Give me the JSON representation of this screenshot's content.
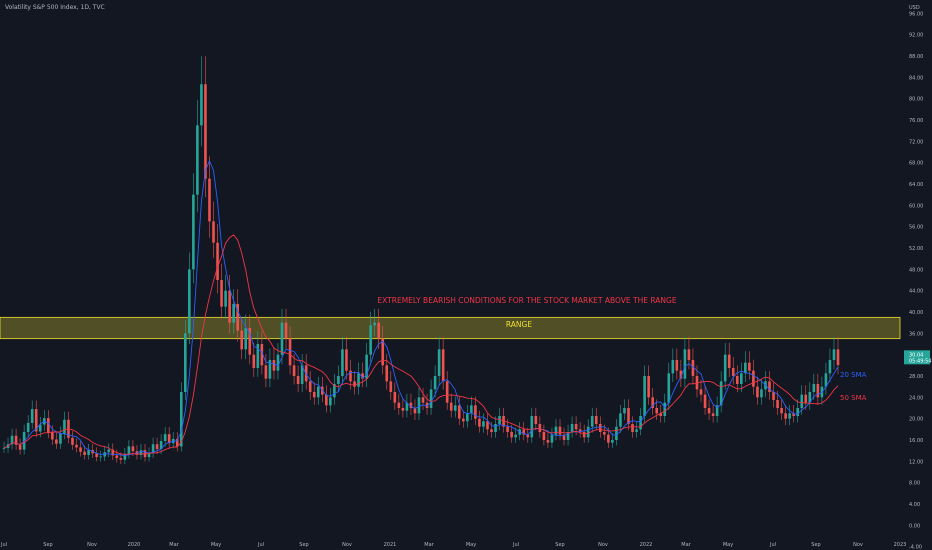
{
  "chart_data": {
    "type": "candlestick",
    "title": "Volatility S&P 500 Index, 1D, TVC",
    "currency": "USD",
    "ylim": [
      -2,
      97
    ],
    "yticks": [
      "96.00",
      "92.00",
      "88.00",
      "84.00",
      "80.00",
      "76.00",
      "72.00",
      "68.00",
      "64.00",
      "60.00",
      "56.00",
      "52.00",
      "48.00",
      "44.00",
      "40.00",
      "36.00",
      "32.00",
      "28.00",
      "24.00",
      "20.00",
      "16.00",
      "12.00",
      "8.00",
      "4.00",
      "0.00",
      "-4.00"
    ],
    "xticks": [
      "Jul",
      "Sep",
      "Nov",
      "2020",
      "Mar",
      "May",
      "Jul",
      "Sep",
      "Nov",
      "2021",
      "Mar",
      "May",
      "Jul",
      "Sep",
      "Nov",
      "2022",
      "Mar",
      "May",
      "Jul",
      "Sep",
      "Nov",
      "2023"
    ],
    "last_price": "30.04",
    "countdown": "05:49:54",
    "range_band": [
      35,
      39
    ],
    "range_label": "RANGE",
    "headline": "EXTREMELY BEARISH CONDITIONS FOR THE STOCK MARKET ABOVE THE RANGE",
    "sma20_label": "20 SMA",
    "sma50_label": "50 SMA",
    "series": [
      {
        "name": "20 SMA",
        "color": "#2962ff"
      },
      {
        "name": "50 SMA",
        "color": "#f23645"
      }
    ],
    "colors": {
      "up": "#26a69a",
      "down": "#ef5350",
      "band": "#f0e130",
      "bg": "#131722"
    },
    "close": [
      14.5,
      15.2,
      16.8,
      15.1,
      14.2,
      17.5,
      19.2,
      21.8,
      17.6,
      18.9,
      20.1,
      17.4,
      16.1,
      15.3,
      17.2,
      19.8,
      16.4,
      15.1,
      14.6,
      13.8,
      13.2,
      14.1,
      13.5,
      12.8,
      12.9,
      13.7,
      14.2,
      13.1,
      12.6,
      12.3,
      13.4,
      14.8,
      13.9,
      13.2,
      14.1,
      12.8,
      13.5,
      15.2,
      14.3,
      15.8,
      17.1,
      15.4,
      16.2,
      14.8,
      25.0,
      36.0,
      48.0,
      62.0,
      75.0,
      82.7,
      65.0,
      57.0,
      53.0,
      46.0,
      41.0,
      44.0,
      38.0,
      41.5,
      36.5,
      33.0,
      37.0,
      32.0,
      29.5,
      34.0,
      30.0,
      27.5,
      31.0,
      29.0,
      32.0,
      38.0,
      35.0,
      30.0,
      28.0,
      26.5,
      30.0,
      27.0,
      25.0,
      24.0,
      26.0,
      24.5,
      22.5,
      24.0,
      26.5,
      28.0,
      33.0,
      29.0,
      27.0,
      26.0,
      28.5,
      27.5,
      32.0,
      37.5,
      38.0,
      35.0,
      30.0,
      27.0,
      25.0,
      23.0,
      22.0,
      21.5,
      23.0,
      22.0,
      21.0,
      24.0,
      23.0,
      22.0,
      25.5,
      28.0,
      33.0,
      27.0,
      23.0,
      21.5,
      22.5,
      20.0,
      19.5,
      21.0,
      22.5,
      20.0,
      18.5,
      19.5,
      18.0,
      17.5,
      19.0,
      20.5,
      18.5,
      17.5,
      16.5,
      17.0,
      18.0,
      17.0,
      16.5,
      20.5,
      19.0,
      17.5,
      16.0,
      15.5,
      17.0,
      18.5,
      17.0,
      16.0,
      17.5,
      19.0,
      18.0,
      17.5,
      16.5,
      18.5,
      20.5,
      19.0,
      17.5,
      17.0,
      15.5,
      16.0,
      18.5,
      21.0,
      22.0,
      19.0,
      17.5,
      18.0,
      20.5,
      28.0,
      24.0,
      22.0,
      21.0,
      20.5,
      23.0,
      28.5,
      31.0,
      29.0,
      27.5,
      33.0,
      31.0,
      28.0,
      25.5,
      24.5,
      22.0,
      21.0,
      20.5,
      22.5,
      27.0,
      32.0,
      29.5,
      28.0,
      26.5,
      28.5,
      30.5,
      29.0,
      26.0,
      24.0,
      25.5,
      27.0,
      25.0,
      23.5,
      22.0,
      21.0,
      20.0,
      21.0,
      20.5,
      22.0,
      24.5,
      23.0,
      25.0,
      26.5,
      24.0,
      26.0,
      28.5,
      31.0,
      33.0,
      30.04
    ]
  }
}
